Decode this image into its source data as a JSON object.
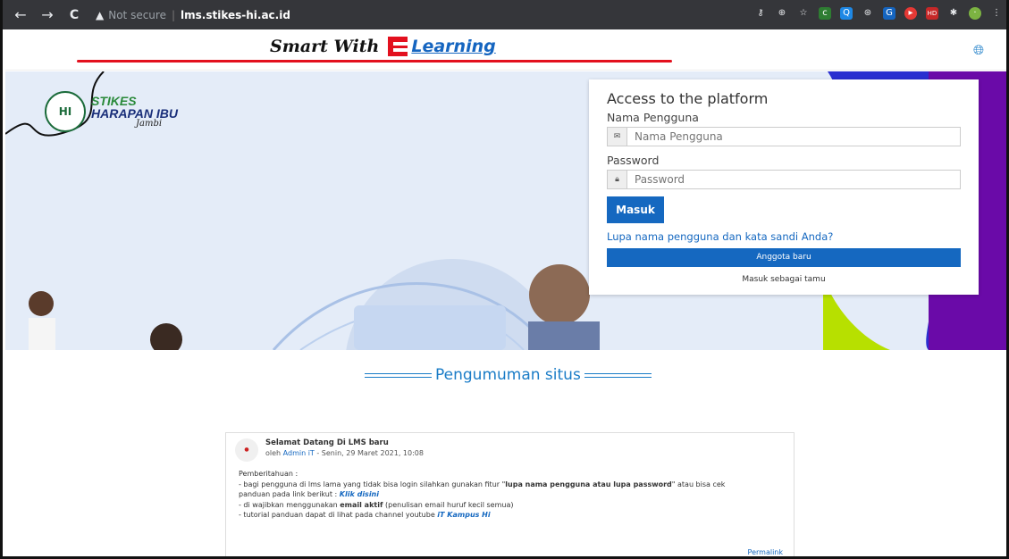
{
  "browser": {
    "security_label": "Not secure",
    "url": "lms.stikes-hi.ac.id"
  },
  "header": {
    "brand_smart": "Smart With",
    "brand_learning": "Learning"
  },
  "logo": {
    "line1": "STIKES",
    "line2": "HARAPAN IBU",
    "line3": "Jambi"
  },
  "login": {
    "title": "Access to the platform",
    "username_label": "Nama Pengguna",
    "username_placeholder": "Nama Pengguna",
    "password_label": "Password",
    "password_placeholder": "Password",
    "submit_label": "Masuk",
    "forgot_label": "Lupa nama pengguna dan kata sandi Anda?",
    "signup_label": "Anggota baru",
    "guest_label": "Masuk sebagai tamu"
  },
  "announcements": {
    "heading": "Pengumuman situs",
    "post": {
      "title": "Selamat Datang Di LMS baru",
      "by": "oleh",
      "author": "Admin iT",
      "date": "- Senin, 29 Maret 2021, 10:08",
      "intro": "Pemberitahuan :",
      "line1_a": "- bagi pengguna di lms lama yang tidak bisa login silahkan gunakan fitur \"",
      "line1_b": "lupa nama pengguna atau lupa password",
      "line1_c": "\" atau bisa cek",
      "line2_a": "panduan pada link berikut : ",
      "line2_link": "Klik disini",
      "line3_a": "- di wajibkan menggunakan ",
      "line3_b": "email aktif",
      "line3_c": " (penulisan email huruf kecil semua)",
      "line4_a": "- tutorial panduan dapat di lihat pada channel youtube ",
      "line4_link": "iT Kampus Hi",
      "permalink": "Permalink"
    }
  },
  "colors": {
    "primary": "#1568c0",
    "accent_red": "#e3101e",
    "purple": "#6a0aa8",
    "hero_bg": "#e4ecf8"
  }
}
